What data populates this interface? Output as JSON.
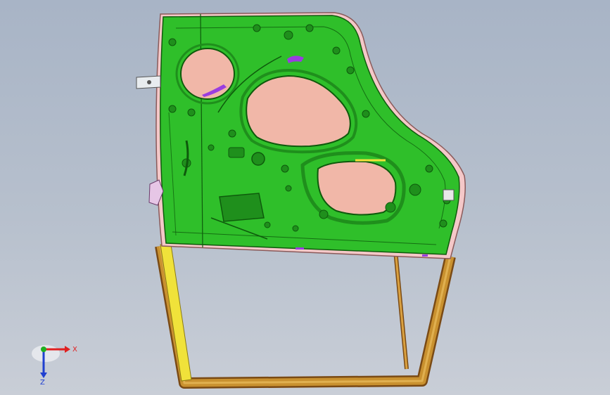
{
  "viewport": {
    "name": "3d-model-viewport",
    "background_top": "#a8b4c6",
    "background_bottom": "#c9ced7"
  },
  "model": {
    "description_name": "car-door-inner-panel",
    "colors": {
      "panel_green": "#2fbf2a",
      "panel_green_dark": "#1f8f1c",
      "opening_pink": "#f1b7a8",
      "frame_gold": "#c9912f",
      "frame_yellow": "#f0e23a",
      "accent_purple": "#9a3de0"
    }
  },
  "triad": {
    "x_label": "X",
    "z_label": "Z",
    "colors": {
      "x": "#e02020",
      "y": "#20b020",
      "z": "#2040d0"
    }
  }
}
